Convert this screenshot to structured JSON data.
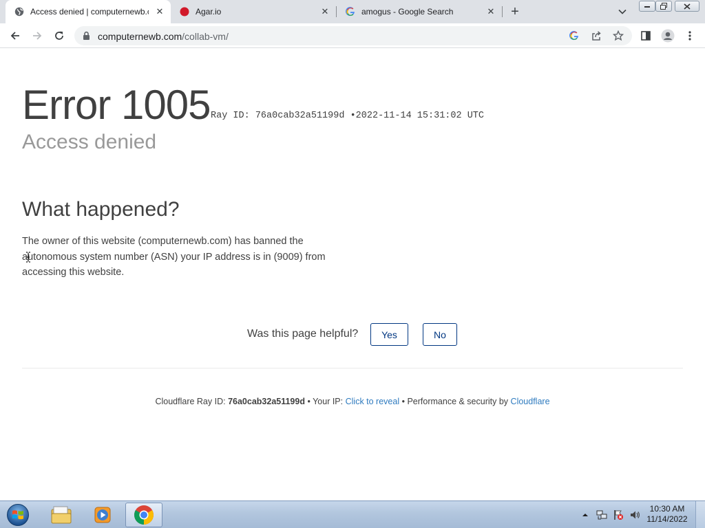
{
  "browser": {
    "tabs": [
      {
        "title": "Access denied | computernewb.c",
        "icon": "globe-icon",
        "active": true
      },
      {
        "title": "Agar.io",
        "icon": "agar-red-dot-icon",
        "active": false
      },
      {
        "title": "amogus - Google Search",
        "icon": "google-g-icon",
        "active": false
      }
    ],
    "url_host": "computernewb.com",
    "url_path": "/collab-vm/"
  },
  "page": {
    "error_title": "Error 1005",
    "ray_label": "Ray ID:",
    "ray_id": "76a0cab32a51199d",
    "bullet": "•",
    "timestamp": "2022-11-14 15:31:02 UTC",
    "subtitle": "Access denied",
    "what_happened_heading": "What happened?",
    "explanation": "The owner of this website (computernewb.com) has banned the autonomous system number (ASN) your IP address is in (9009) from accessing this website.",
    "feedback_question": "Was this page helpful?",
    "yes_label": "Yes",
    "no_label": "No",
    "footer": {
      "ray_label": "Cloudflare Ray ID:",
      "ray_id": "76a0cab32a51199d",
      "sep1": "•",
      "ip_label": "Your IP:",
      "ip_link": "Click to reveal",
      "sep2": "•",
      "perf_label": "Performance & security by",
      "cloudflare_link": "Cloudflare"
    }
  },
  "taskbar": {
    "time": "10:30 AM",
    "date": "11/14/2022",
    "items": [
      "windows-explorer-icon",
      "media-player-icon",
      "chrome-icon"
    ]
  },
  "colors": {
    "link": "#2f7bbf",
    "button_border": "#003681",
    "heading": "#404040",
    "subtitle": "#999999"
  }
}
